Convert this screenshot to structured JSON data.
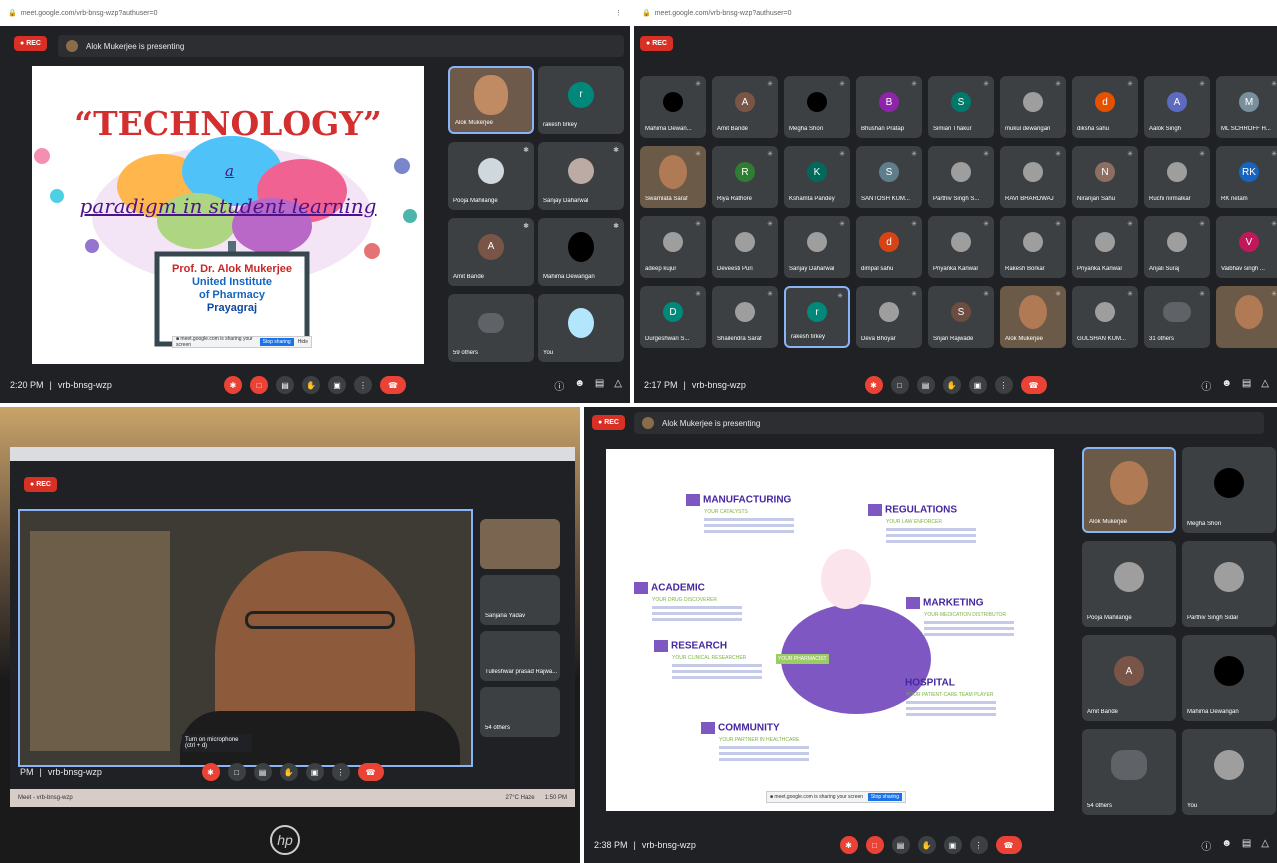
{
  "q1": {
    "url": "meet.google.com/vrb-bnsg-wzp?authuser=0",
    "rec_label": "REC",
    "presenting": "Alok Mukerjee is presenting",
    "slide": {
      "title": "“TECHNOLOGY”",
      "a": "a",
      "subtitle": "paradigm in student learning",
      "presenter_name": "Prof. Dr. Alok Mukerjee",
      "inst1": "United Institute",
      "inst2": "of Pharmacy",
      "city": "Prayagraj",
      "stop_btn": "Stop sharing",
      "hide_btn": "Hide"
    },
    "tiles": [
      {
        "name": "Alok Mukerjee",
        "type": "video"
      },
      {
        "name": "rakesh tirkey",
        "initial": "r",
        "color": "#00897b"
      },
      {
        "name": "Pooja Mahilange",
        "type": "photo"
      },
      {
        "name": "Sanjay Daharwal",
        "type": "photo"
      },
      {
        "name": "Amit Bande",
        "initial": "A",
        "color": "#795548"
      },
      {
        "name": "Mahima Dewangan",
        "type": "dark"
      },
      {
        "name": "59 others",
        "type": "group"
      },
      {
        "name": "You",
        "type": "photo"
      }
    ],
    "time": "2:20 PM",
    "code": "vrb-bnsg-wzp"
  },
  "q2": {
    "url": "meet.google.com/vrb-bnsg-wzp?authuser=0",
    "rec_label": "REC",
    "grid": [
      {
        "name": "Mahima Dewan...",
        "type": "dark"
      },
      {
        "name": "Amit Bande",
        "initial": "A",
        "color": "#795548"
      },
      {
        "name": "Megha Shori",
        "type": "dark"
      },
      {
        "name": "Bhushan Pratap",
        "initial": "B",
        "color": "#8e24aa"
      },
      {
        "name": "Simian Thakur",
        "initial": "S",
        "color": "#00796b"
      },
      {
        "name": "mukul dewangan",
        "type": "photo"
      },
      {
        "name": "diksha sahu",
        "initial": "d",
        "color": "#e65100"
      },
      {
        "name": "Aalok Singh",
        "initial": "A",
        "color": "#5c6bc0"
      },
      {
        "name": "ML SCHROFF H...",
        "initial": "M",
        "color": "#78909c"
      },
      {
        "name": "Swarnlata Saraf",
        "type": "video"
      },
      {
        "name": "Riya Rathore",
        "initial": "R",
        "color": "#2e7d32"
      },
      {
        "name": "Kshamta Pandey",
        "initial": "K",
        "color": "#00695c"
      },
      {
        "name": "SANTOSH KUM...",
        "initial": "S",
        "color": "#607d8b"
      },
      {
        "name": "Parthiv Singh S...",
        "type": "photo"
      },
      {
        "name": "RAVI BHARDWAJ",
        "type": "photo"
      },
      {
        "name": "Niranjan Sahu",
        "initial": "N",
        "color": "#8d6e63"
      },
      {
        "name": "Ruchi nirmalkar",
        "type": "photo"
      },
      {
        "name": "RK netam",
        "initial": "RK",
        "color": "#1565c0"
      },
      {
        "name": "adeep kujur",
        "type": "photo"
      },
      {
        "name": "Deveesti Puri",
        "type": "photo"
      },
      {
        "name": "Sanjay Daharwal",
        "type": "photo"
      },
      {
        "name": "dimpal sahu",
        "initial": "d",
        "color": "#d84315"
      },
      {
        "name": "Priyanka Kanwar",
        "type": "photo"
      },
      {
        "name": "Rakesh Borkar",
        "type": "photo"
      },
      {
        "name": "Priyanka Kanwar",
        "type": "photo"
      },
      {
        "name": "Anjali Suraj",
        "type": "photo"
      },
      {
        "name": "Vaibhav singh ...",
        "initial": "V",
        "color": "#c2185b"
      },
      {
        "name": "Durgeshwari S...",
        "initial": "D",
        "color": "#00897b"
      },
      {
        "name": "Shailendra Saraf",
        "type": "photo"
      },
      {
        "name": "rakesh tirkey",
        "initial": "r",
        "color": "#00897b",
        "active": true
      },
      {
        "name": "Deva Bhoyar",
        "type": "photo"
      },
      {
        "name": "Srijan Rajwade",
        "initial": "S",
        "color": "#6d4c41"
      },
      {
        "name": "Alok Mukerjee",
        "type": "video"
      },
      {
        "name": "GULSHAN KUM...",
        "type": "photo"
      },
      {
        "name": "31 others",
        "type": "group"
      },
      {
        "name": "",
        "type": "video2"
      }
    ],
    "time": "2:17 PM",
    "code": "vrb-bnsg-wzp"
  },
  "q3": {
    "rec_label": "REC",
    "tiles": [
      "Sanjana Yadav",
      "Tulleshwar prasad Rajwa...",
      "54 others"
    ],
    "tooltip": "Turn on microphone (ctrl + d)",
    "time": "PM",
    "code": "vrb-bnsg-wzp",
    "taskbar_item": "Meet - vrb-bnsg-wzp",
    "weather": "27°C Haze",
    "clock": "1:50 PM",
    "logo": "hp"
  },
  "q4": {
    "rec_label": "REC",
    "presenting": "Alok Mukerjee is presenting",
    "slide": {
      "sections": [
        {
          "title": "MANUFACTURING",
          "sub": "YOUR CATALYSTS"
        },
        {
          "title": "REGULATIONS",
          "sub": "YOUR LAW ENFORCER"
        },
        {
          "title": "ACADEMIC",
          "sub": "YOUR DRUG DISCOVERER"
        },
        {
          "title": "MARKETING",
          "sub": "YOUR MEDICATION DISTRIBUTOR"
        },
        {
          "title": "RESEARCH",
          "sub": "YOUR CLINICAL RESEARCHER"
        },
        {
          "title": "HOSPITAL",
          "sub": "YOUR PATIENT-CARE TEAM PLAYER"
        },
        {
          "title": "COMMUNITY",
          "sub": "YOUR PARTNER IN HEALTHCARE"
        }
      ],
      "center_label": "YOUR PHARMACIST",
      "stop_btn": "Stop sharing"
    },
    "tiles": [
      {
        "name": "Alok Mukerjee",
        "type": "video"
      },
      {
        "name": "Megha Shori",
        "type": "dark"
      },
      {
        "name": "Pooja Mahilange",
        "type": "photo"
      },
      {
        "name": "Parthiv Singh Sidar",
        "type": "photo"
      },
      {
        "name": "Amit Bande",
        "initial": "A",
        "color": "#795548"
      },
      {
        "name": "Mahima Dewangan",
        "type": "dark"
      },
      {
        "name": "54 others",
        "type": "group"
      },
      {
        "name": "You",
        "type": "photo"
      }
    ],
    "time": "2:38 PM",
    "code": "vrb-bnsg-wzp"
  }
}
